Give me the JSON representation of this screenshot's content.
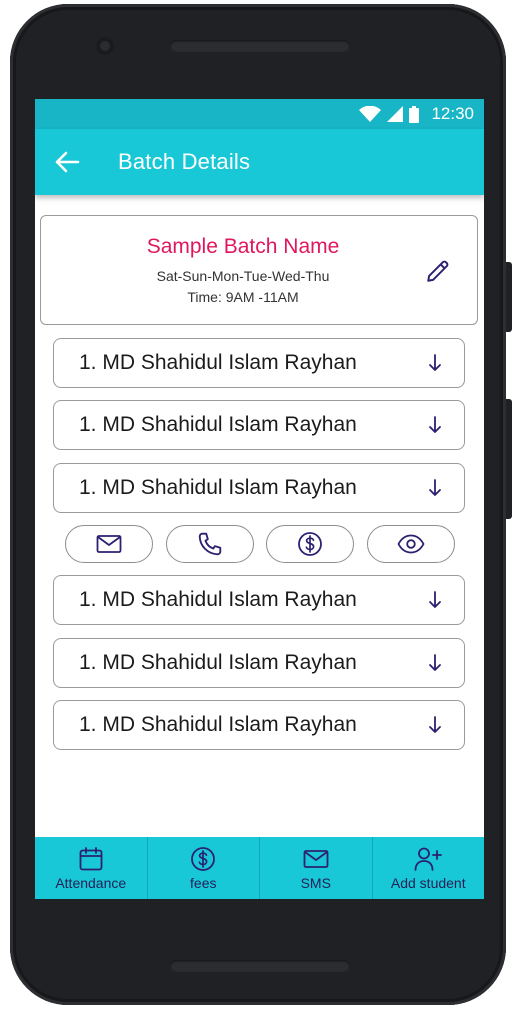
{
  "status_bar": {
    "time": "12:30"
  },
  "app_bar": {
    "title": "Batch Details"
  },
  "batch": {
    "name": "Sample Batch Name",
    "days": "Sat-Sun-Mon-Tue-Wed-Thu",
    "time": "Time: 9AM -11AM"
  },
  "students": [
    {
      "label": "1. MD Shahidul Islam Rayhan"
    },
    {
      "label": "1. MD Shahidul Islam Rayhan"
    },
    {
      "label": "1. MD Shahidul Islam Rayhan"
    },
    {
      "label": "1. MD Shahidul Islam Rayhan"
    },
    {
      "label": "1. MD Shahidul Islam Rayhan"
    },
    {
      "label": "1. MD Shahidul Islam Rayhan"
    }
  ],
  "actions": [
    "mail-icon",
    "phone-icon",
    "dollar-icon",
    "eye-icon"
  ],
  "bottom_nav": [
    {
      "label": "Attendance",
      "icon": "calendar-icon"
    },
    {
      "label": "fees",
      "icon": "dollar-icon"
    },
    {
      "label": "SMS",
      "icon": "mail-icon"
    },
    {
      "label": "Add student",
      "icon": "add-user-icon"
    }
  ],
  "colors": {
    "status_bar": "#17b5c5",
    "app_bar": "#19c8d6",
    "batch_name": "#e0175e",
    "icon": "#2b2170"
  }
}
